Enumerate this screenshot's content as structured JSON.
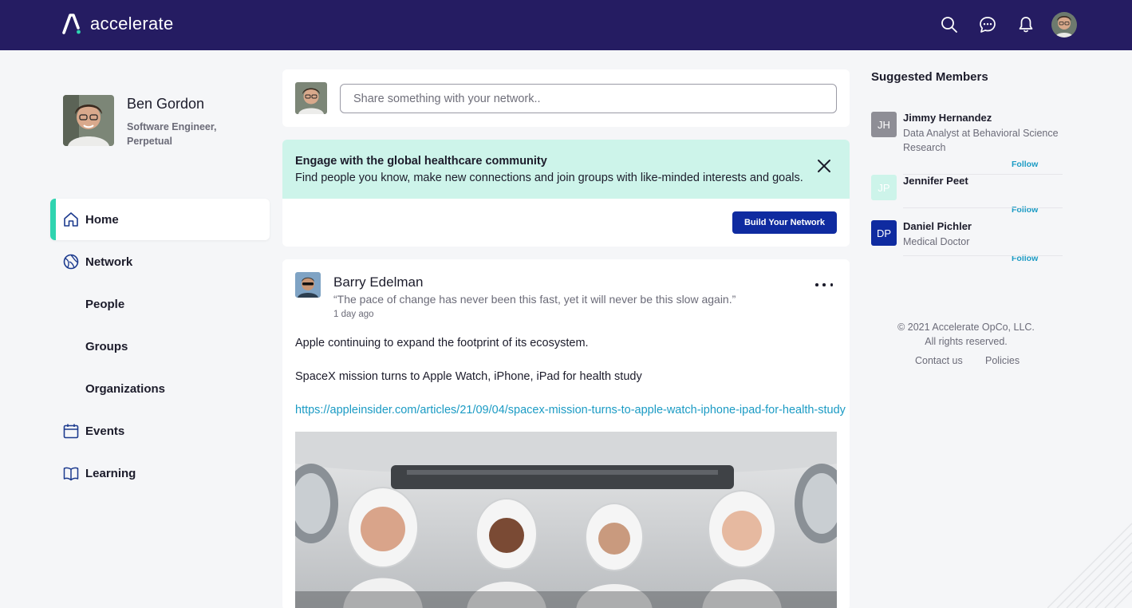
{
  "app": {
    "name": "accelerate"
  },
  "topbar": {
    "icons": [
      "search-icon",
      "chat-icon",
      "bell-icon"
    ]
  },
  "profile": {
    "name": "Ben Gordon",
    "title": "Software Engineer, Perpetual"
  },
  "nav": {
    "items": [
      {
        "label": "Home",
        "icon": "home-icon",
        "active": true
      },
      {
        "label": "Network",
        "icon": "globe-icon"
      },
      {
        "label": "People"
      },
      {
        "label": "Groups"
      },
      {
        "label": "Organizations"
      },
      {
        "label": "Events",
        "icon": "calendar-icon"
      },
      {
        "label": "Learning",
        "icon": "book-icon"
      }
    ]
  },
  "composer": {
    "placeholder": "Share something with your network.."
  },
  "engage": {
    "title": "Engage with the global healthcare community",
    "subtitle": "Find people you know, make new connections and join groups with like-minded interests and goals.",
    "button": "Build Your Network"
  },
  "post": {
    "author": "Barry Edelman",
    "quote": "“The pace of change has never been this fast, yet it will never be this slow again.”",
    "time": "1 day ago",
    "text1": "Apple continuing to expand the footprint of its ecosystem.",
    "text2": "SpaceX mission turns to Apple Watch, iPhone, iPad for health study",
    "link": "https://appleinsider.com/articles/21/09/04/spacex-mission-turns-to-apple-watch-iphone-ipad-for-health-study"
  },
  "suggested": {
    "title": "Suggested Members",
    "follow_label": "Follow",
    "members": [
      {
        "initials": "JH",
        "name": "Jimmy Hernandez",
        "role": "Data Analyst at Behavioral Science Research",
        "color": "#8e8e96"
      },
      {
        "initials": "JP",
        "name": "Jennifer Peet",
        "role": "",
        "color": "#cdf4ea"
      },
      {
        "initials": "DP",
        "name": "Daniel Pichler",
        "role": "Medical Doctor",
        "color": "#0f2ba0"
      }
    ]
  },
  "footer": {
    "copyright_line1": "© 2021 Accelerate OpCo, LLC.",
    "copyright_line2": "All rights reserved.",
    "contact": "Contact us",
    "policies": "Policies"
  },
  "colors": {
    "topbar": "#251c62",
    "accent": "#2fd4b0",
    "primary_button": "#0f2ba0",
    "link": "#1b9bc4",
    "banner": "#cdf4ea"
  }
}
